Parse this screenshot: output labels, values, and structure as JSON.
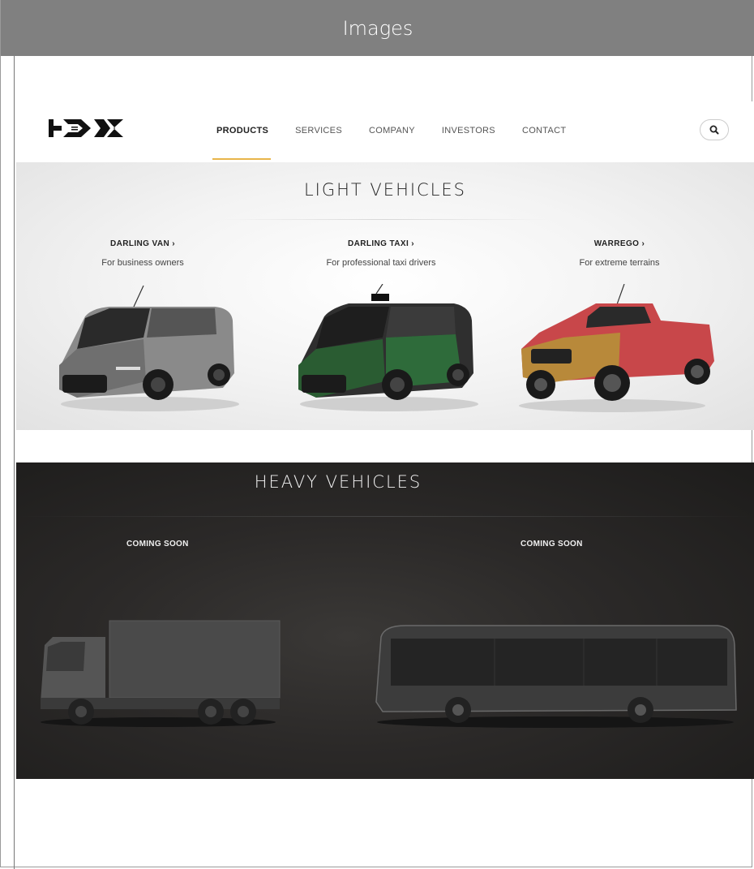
{
  "window": {
    "title": "Images"
  },
  "nav": {
    "items": [
      {
        "label": "PRODUCTS",
        "active": true
      },
      {
        "label": "SERVICES",
        "active": false
      },
      {
        "label": "COMPANY",
        "active": false
      },
      {
        "label": "INVESTORS",
        "active": false
      },
      {
        "label": "CONTACT",
        "active": false
      }
    ],
    "search_icon": "search-icon",
    "accent_color": "#e8b54a"
  },
  "light": {
    "title": "LIGHT VEHICLES",
    "vehicles": [
      {
        "name": "DARLING VAN ›",
        "desc": "For business owners"
      },
      {
        "name": "DARLING TAXI ›",
        "desc": "For professional taxi drivers"
      },
      {
        "name": "WARREGO ›",
        "desc": "For extreme terrains"
      }
    ]
  },
  "heavy": {
    "title": "HEAVY VEHICLES",
    "items": [
      {
        "label": "COMING SOON"
      },
      {
        "label": "COMING SOON"
      }
    ]
  }
}
